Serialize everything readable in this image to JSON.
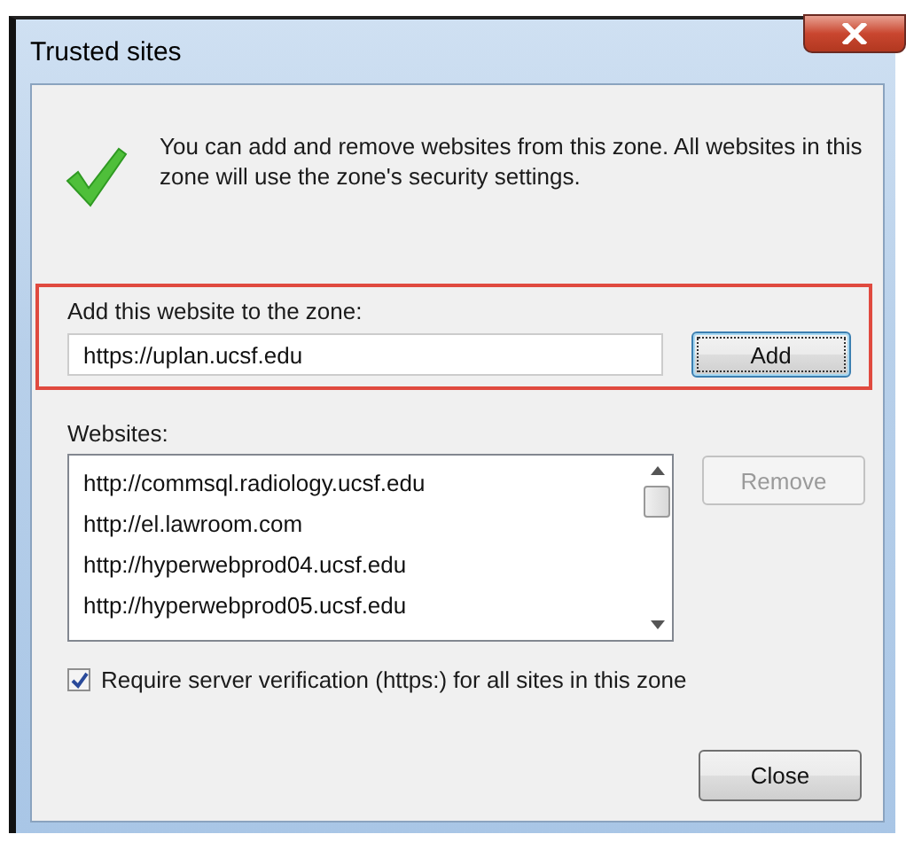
{
  "window": {
    "title": "Trusted sites"
  },
  "info": {
    "text": "You can add and remove websites from this zone. All websites in this zone will use the zone's security settings."
  },
  "add_section": {
    "label": "Add this website to the zone:",
    "value": "https://uplan.ucsf.edu",
    "highlighted": true
  },
  "add_button": {
    "label": "Add",
    "focused": true
  },
  "websites": {
    "label": "Websites:",
    "items": [
      {
        "text": "http://commsql.radiology.ucsf.edu",
        "selected": false
      },
      {
        "text": "http://el.lawroom.com",
        "selected": false
      },
      {
        "text": "http://hyperwebprod04.ucsf.edu",
        "selected": false
      },
      {
        "text": "http://hyperwebprod05.ucsf.edu",
        "selected": false
      }
    ]
  },
  "remove_button": {
    "label": "Remove",
    "disabled": true
  },
  "require_verification": {
    "label": "Require server verification (https:) for all sites in this zone",
    "checked": true
  },
  "buttons": [
    {
      "label": "Close"
    }
  ]
}
